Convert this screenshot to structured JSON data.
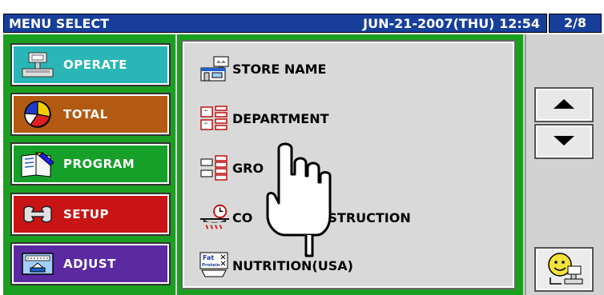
{
  "titlebar": {
    "title": "MENU SELECT",
    "datetime": "JUN-21-2007(THU)  12:54"
  },
  "page_indicator": "2/8",
  "categories": [
    {
      "label": "OPERATE",
      "color": "#2ab6b6",
      "icon": "operate-icon"
    },
    {
      "label": "TOTAL",
      "color": "#b35a12",
      "icon": "pie-chart-icon"
    },
    {
      "label": "PROGRAM",
      "color": "#16a02a",
      "icon": "book-icon"
    },
    {
      "label": "SETUP",
      "color": "#c81414",
      "icon": "wrench-icon"
    },
    {
      "label": "ADJUST",
      "color": "#5b2aa0",
      "icon": "scale-icon"
    }
  ],
  "menu_items": [
    {
      "label": "STORE NAME",
      "icon": "store-icon"
    },
    {
      "label": "DEPARTMENT",
      "icon": "department-icon"
    },
    {
      "label": "GRO",
      "icon": "group-icon"
    },
    {
      "label": "CO",
      "label2": "G INSTRUCTION",
      "icon": "clock-cooking-icon"
    },
    {
      "label": "NUTRITION(USA)",
      "icon": "nutrition-label-icon",
      "icon_text": "Fat",
      "icon_text2": "Protein"
    }
  ],
  "nav": {
    "up": "up-arrow-icon",
    "down": "down-arrow-icon",
    "help": "operator-icon"
  }
}
